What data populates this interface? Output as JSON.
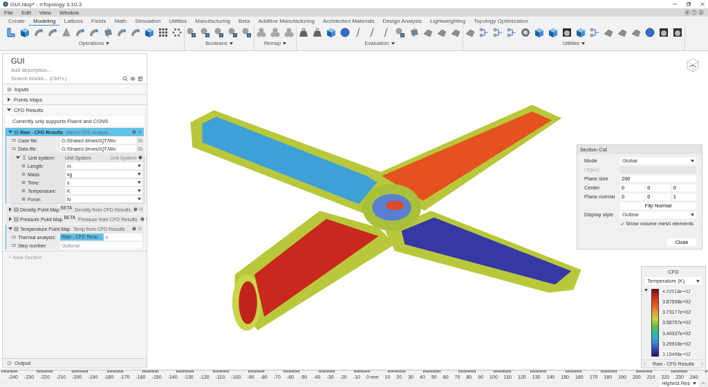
{
  "window": {
    "title": "GUI.ntop* - nTopology 3.10.3"
  },
  "menu": [
    "File",
    "Edit",
    "View",
    "Window"
  ],
  "ribbon_tabs": [
    {
      "label": "Create",
      "selected": false
    },
    {
      "label": "Modeling",
      "selected": true
    },
    {
      "label": "Lattices",
      "selected": false
    },
    {
      "label": "Fields",
      "selected": false
    },
    {
      "label": "Math",
      "selected": false
    },
    {
      "label": "Simulation",
      "selected": false
    },
    {
      "label": "Utilities",
      "selected": false
    },
    {
      "label": "Manufacturing",
      "selected": false
    },
    {
      "label": "Beta",
      "selected": false
    },
    {
      "label": "Additive Manufacturing",
      "selected": false
    },
    {
      "label": "Architected Materials",
      "selected": false
    },
    {
      "label": "Design Analysis",
      "selected": false
    },
    {
      "label": "Lightweighting",
      "selected": false
    },
    {
      "label": "Topology Optimization",
      "selected": false
    }
  ],
  "toolbar_groups": [
    {
      "label": "Operations"
    },
    {
      "label": "Booleans"
    },
    {
      "label": "Remap"
    },
    {
      "label": "Evaluation"
    },
    {
      "label": "Utilities"
    }
  ],
  "notebook": {
    "title": "GUI",
    "description_placeholder": "Add description...",
    "search_placeholder": "Search blocks... (Ctrl+L)",
    "sections": [
      {
        "kind": "inputs",
        "label": "Inputs"
      },
      {
        "kind": "section",
        "label": "Points Maps",
        "expanded": false
      },
      {
        "kind": "section",
        "label": "CFD Results",
        "expanded": true,
        "note": "Currently only supports Fluent and CGNS",
        "blocks": [
          {
            "name": "Raw - CFD Results",
            "type": "Import CFD Analysi...",
            "expanded": true,
            "selected": true,
            "children": [
              {
                "kind": "file",
                "label": "Case file:",
                "value": "G:/Shared drives/IQT/Wo"
              },
              {
                "kind": "file",
                "label": "Data file:",
                "value": "G:/Shared drives/IQT/Wo"
              },
              {
                "kind": "group",
                "label": "Unit system:",
                "type": "Unit System",
                "hint": "Unit System",
                "expanded": true,
                "children": [
                  {
                    "kind": "dropdown",
                    "label": "Length:",
                    "value": "m"
                  },
                  {
                    "kind": "dropdown",
                    "label": "Mass:",
                    "value": "kg"
                  },
                  {
                    "kind": "dropdown",
                    "label": "Time:",
                    "value": "s"
                  },
                  {
                    "kind": "dropdown",
                    "label": "Temperature:",
                    "value": "K"
                  },
                  {
                    "kind": "dropdown",
                    "label": "Force:",
                    "value": "N"
                  }
                ]
              }
            ]
          },
          {
            "name": "Density Point Map",
            "badge": "BETA",
            "type": "Density from CFD Results",
            "expanded": false,
            "selected": false
          },
          {
            "name": "Pressure Point Map",
            "badge": "BETA",
            "type": "Pressure from CFD Results",
            "expanded": false,
            "selected": false
          },
          {
            "name": "Temperature Point Map",
            "type": "Temp from CFD Results",
            "expanded": true,
            "selected": false,
            "children": [
              {
                "kind": "chip",
                "label": "Thermal analysis:",
                "value": "Raw - CFD Resu..."
              },
              {
                "kind": "text",
                "label": "Step number:",
                "placeholder": "Optional"
              }
            ]
          }
        ]
      }
    ],
    "new_section": "+ New Section",
    "output_label": "Output:"
  },
  "section_cut": {
    "title": "Section Cut",
    "rows": [
      {
        "kind": "dropdown",
        "label": "Mode",
        "value": "Global"
      },
      {
        "kind": "fields",
        "label": "Object",
        "disabled": true
      },
      {
        "kind": "fields",
        "label": "Plane size",
        "disabled": false,
        "values": [
          "200"
        ]
      },
      {
        "kind": "fields",
        "label": "Center",
        "disabled": false,
        "values": [
          "0",
          "0",
          "0"
        ]
      },
      {
        "kind": "fields",
        "label": "Plane normal",
        "disabled": false,
        "values": [
          "0",
          "0",
          "1"
        ]
      },
      {
        "kind": "button",
        "label": "Flip Normal"
      },
      {
        "kind": "dropdown",
        "label": "Display style",
        "value": "Outline"
      },
      {
        "kind": "checkbox",
        "label": "Show volume mesh elements",
        "checked": true
      }
    ],
    "close": "Close"
  },
  "legend": {
    "title": "CFD",
    "quantity": "Temperature (K)",
    "ticks": [
      "4.02018e+02",
      "3.87598e+02",
      "3.73177e+02",
      "3.58757e+02",
      "3.44337e+02",
      "3.29916e+02",
      "3.15496e+02"
    ],
    "source": "Raw - CFD Results"
  },
  "ruler": {
    "labels": [
      "-240",
      "-230",
      "-220",
      "-210",
      "-200",
      "-190",
      "-180",
      "-170",
      "-160",
      "-150",
      "-140",
      "-130",
      "-120",
      "-110",
      "-100",
      "-90",
      "-80",
      "-70",
      "-60",
      "-50",
      "-40",
      "-30",
      "-20",
      "-10",
      "0 mm",
      "10",
      "20",
      "30",
      "40",
      "50",
      "60",
      "70",
      "80",
      "90",
      "100",
      "110",
      "120",
      "130",
      "140",
      "150",
      "160",
      "170",
      "180",
      "190",
      "200",
      "210",
      "220",
      "230",
      "240"
    ]
  },
  "status_bar": {
    "resolution": "Highest Res"
  }
}
